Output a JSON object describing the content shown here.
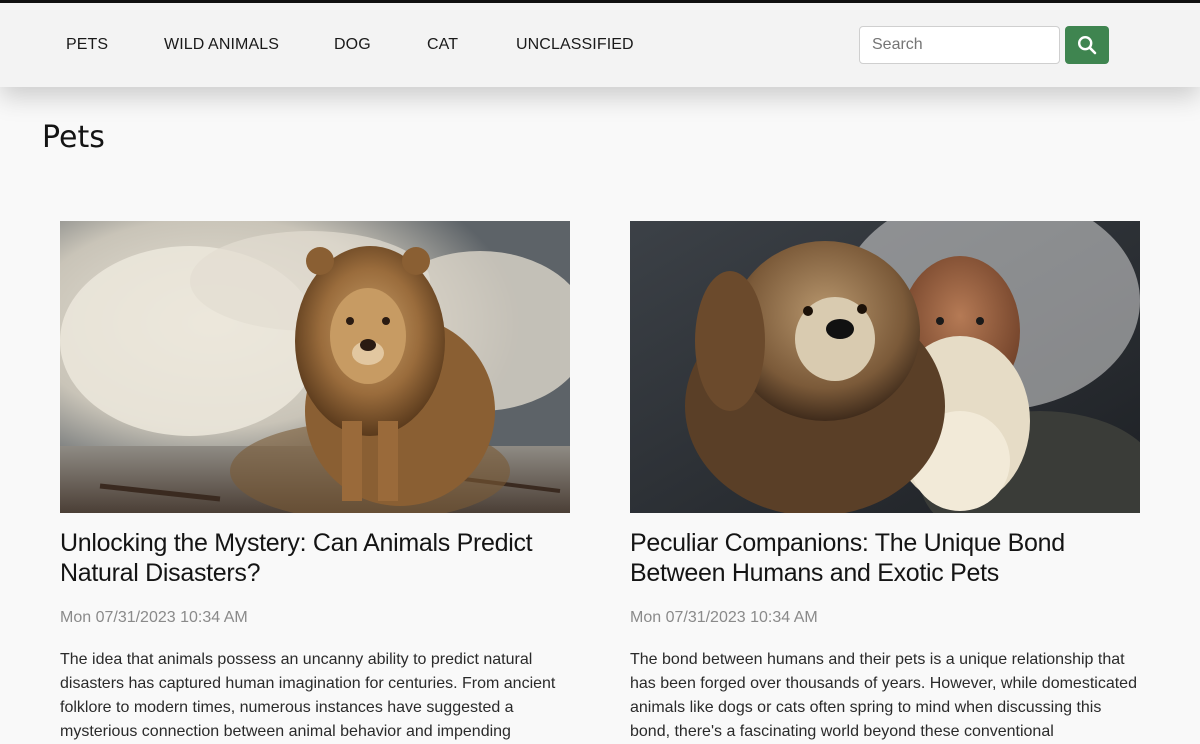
{
  "nav": {
    "items": [
      {
        "label": "PETS"
      },
      {
        "label": "WILD ANIMALS"
      },
      {
        "label": "DOG"
      },
      {
        "label": "CAT"
      },
      {
        "label": "UNCLASSIFIED"
      }
    ]
  },
  "search": {
    "placeholder": "Search",
    "button_icon": "search-icon",
    "button_color": "#3f8550"
  },
  "page": {
    "title": "Pets"
  },
  "articles": [
    {
      "image_icon": "lion-image",
      "title": "Unlocking the Mystery: Can Animals Predict Natural Disasters?",
      "date": "Mon 07/31/2023 10:34 AM",
      "excerpt": "The idea that animals possess an uncanny ability to predict natural disasters has captured human imagination for centuries. From ancient folklore to modern times, numerous instances have suggested a mysterious connection between animal behavior and impending"
    },
    {
      "image_icon": "dog-and-old-man-image",
      "title": "Peculiar Companions: The Unique Bond Between Humans and Exotic Pets",
      "date": "Mon 07/31/2023 10:34 AM",
      "excerpt": "The bond between humans and their pets is a unique relationship that has been forged over thousands of years. However, while domesticated animals like dogs or cats often spring to mind when discussing this bond, there's a fascinating world beyond these conventional"
    }
  ]
}
